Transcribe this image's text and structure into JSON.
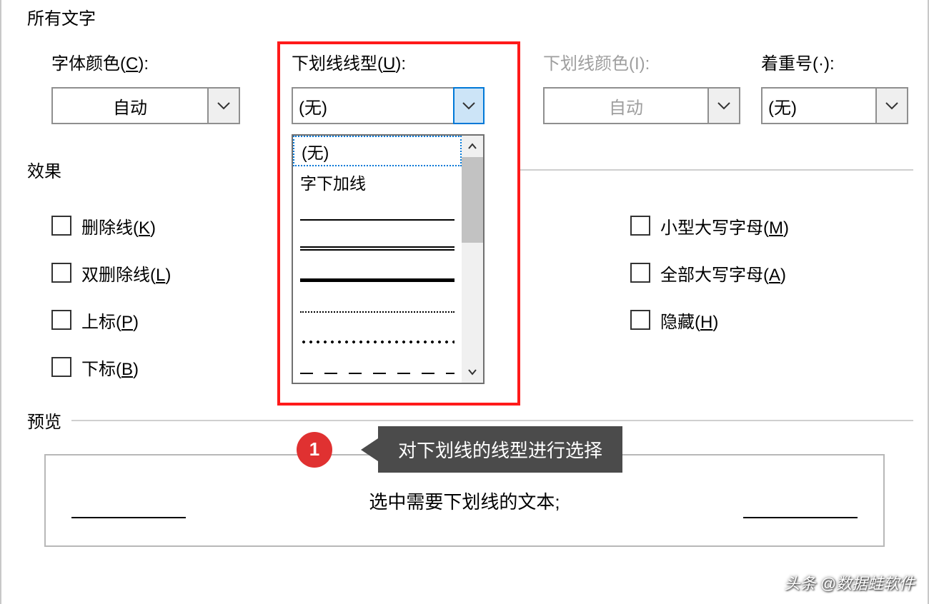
{
  "section_all_text": "所有文字",
  "labels": {
    "font_color": "字体颜色(",
    "font_color_key": "C",
    "font_color_suffix": "):",
    "underline_style": "下划线线型(",
    "underline_style_key": "U",
    "underline_style_suffix": "):",
    "underline_color": "下划线颜色(I):",
    "emphasis": "着重号(·):"
  },
  "combos": {
    "font_color_value": "自动",
    "underline_style_value": "(无)",
    "underline_color_value": "自动",
    "emphasis_value": "(无)"
  },
  "dropdown": {
    "opt_none": "(无)",
    "opt_word_underline": "字下加线"
  },
  "section_effects": "效果",
  "effects_left": [
    {
      "pre": "删除线(",
      "key": "K",
      "suf": ")"
    },
    {
      "pre": "双删除线(",
      "key": "L",
      "suf": ")"
    },
    {
      "pre": "上标(",
      "key": "P",
      "suf": ")"
    },
    {
      "pre": "下标(",
      "key": "B",
      "suf": ")"
    }
  ],
  "effects_right": [
    {
      "pre": "小型大写字母(",
      "key": "M",
      "suf": ")"
    },
    {
      "pre": "全部大写字母(",
      "key": "A",
      "suf": ")"
    },
    {
      "pre": "隐藏(",
      "key": "H",
      "suf": ")"
    }
  ],
  "section_preview": "预览",
  "preview_text": "选中需要下划线的文本;",
  "callout_num": "1",
  "callout_text": "对下划线的线型进行选择",
  "watermark": "头条 @数据蛙软件"
}
